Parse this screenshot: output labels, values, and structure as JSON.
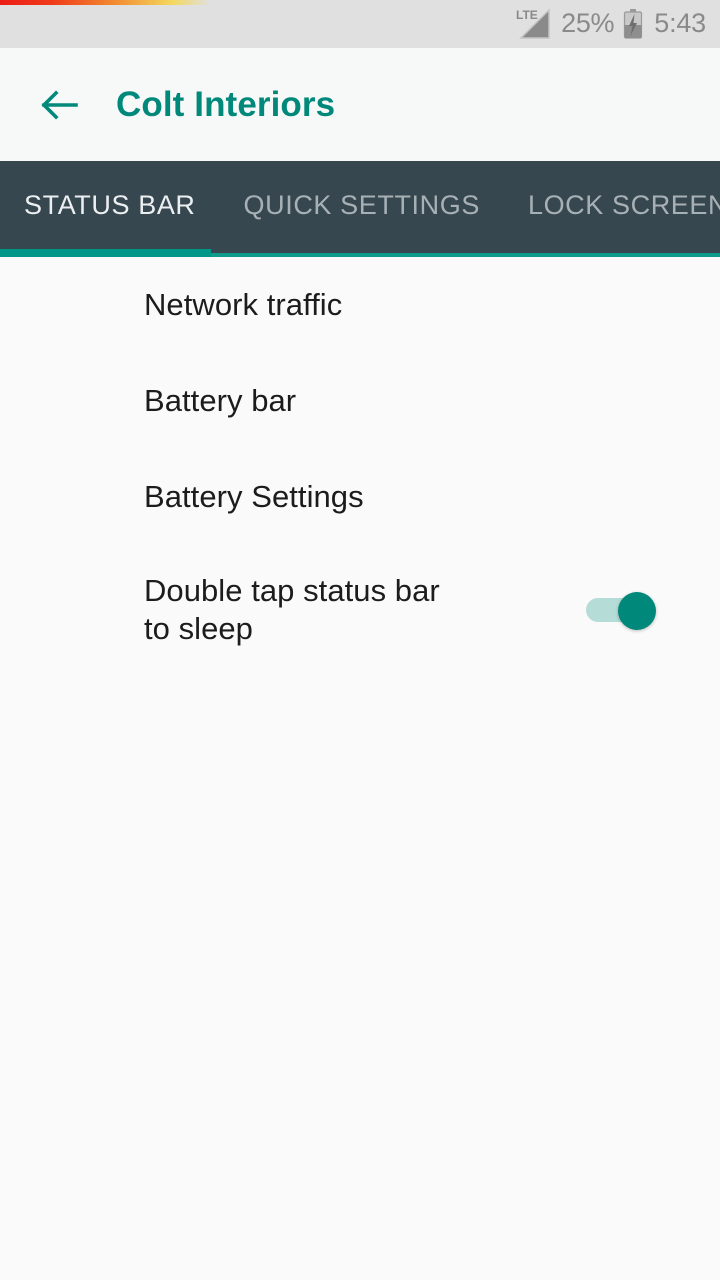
{
  "status_bar": {
    "network_label": "LTE",
    "signal_icon": "signal-triangle-icon",
    "battery_percent": "25%",
    "battery_icon": "battery-charging-icon",
    "time": "5:43",
    "background_color": "#e0e0e0",
    "text_color": "#8a8a8a"
  },
  "app_bar": {
    "back_icon": "arrow-back-icon",
    "title": "Colt Interiors",
    "accent_color": "#00897b",
    "background_color": "#f7f8f8"
  },
  "tabs": {
    "background_color": "#37474f",
    "indicator_color": "#009688",
    "selected_index": 0,
    "items": [
      {
        "label": "STATUS BAR",
        "selected": true
      },
      {
        "label": "QUICK SETTINGS",
        "selected": false
      },
      {
        "label": "LOCK SCREEN PR",
        "selected": false
      }
    ]
  },
  "main": {
    "background_color": "#fafafa",
    "rows": [
      {
        "title": "Network traffic",
        "type": "navigation"
      },
      {
        "title": "Battery bar",
        "type": "navigation"
      },
      {
        "title": "Battery Settings",
        "type": "navigation"
      },
      {
        "title": "Double tap status bar to sleep",
        "type": "switch",
        "switch_state": "on"
      }
    ]
  }
}
